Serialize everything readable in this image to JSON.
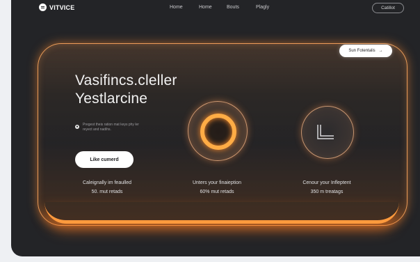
{
  "nav": {
    "logo_text": "VITVICE",
    "links": [
      "Home",
      "Home",
      "Bouts",
      "Plagly"
    ],
    "cta_label": "Catillot"
  },
  "hero": {
    "badge_label": "Sun Fotentalis",
    "badge_arrow": "→",
    "title_line1": "Vasifincs.cleller",
    "title_line2": "Yestlarcine",
    "note_text": "Pregest theis ration mat keys phy ler reyect and nadihs.",
    "button_label": "Like cumerd"
  },
  "stats": [
    {
      "label": "Caleignally im feaulled",
      "value": "50. mut retads"
    },
    {
      "label": "Unters your finaieption",
      "value": "60% mut retads"
    },
    {
      "label": "Cenour your Infleptent",
      "value": "350 m treatags"
    }
  ],
  "colors": {
    "accent": "#ff9a3d",
    "background": "#232427",
    "page": "#eef0f3"
  }
}
